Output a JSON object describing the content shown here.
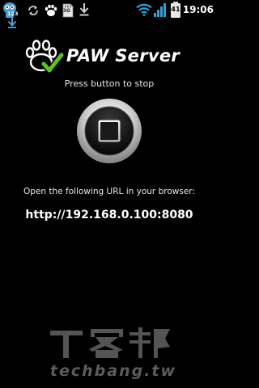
{
  "status_bar": {
    "clock": "19:06",
    "battery_level": "41",
    "network_label": "3G",
    "notification_badge": "123",
    "icons": [
      "android-robot-icon",
      "sync-icon",
      "paw-icon",
      "sd-card-icon",
      "download-icon",
      "wifi-icon",
      "signal-icon",
      "battery-icon"
    ]
  },
  "app": {
    "title": "PAW Server",
    "logo_icon": "paw-check-icon",
    "instruction": "Press button to stop",
    "stop_button_icon": "stop-icon",
    "url_prompt": "Open the following URL in your browser:",
    "server_url": "http://192.168.0.100:8080"
  },
  "watermark": {
    "chinese_text": "T客邦",
    "latin_text": "techbang.tw"
  },
  "colors": {
    "background": "#000000",
    "text": "#ffffff",
    "wifi": "#2ea3d8",
    "button_ring": "#cfcfcf"
  }
}
